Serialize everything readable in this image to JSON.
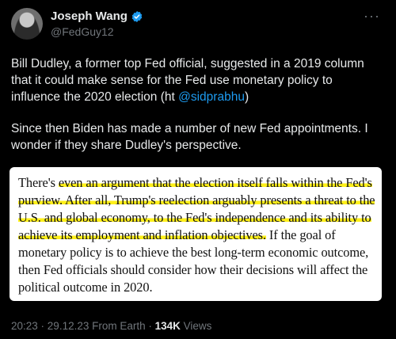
{
  "author": {
    "display_name": "Joseph Wang",
    "handle": "@FedGuy12",
    "verified": true,
    "icons": {
      "verified": "verified-badge-icon",
      "more": "more-options-icon"
    }
  },
  "tweet": {
    "p1_before": "Bill Dudley, a former top Fed official, suggested in a 2019 column that it could make sense for the Fed use monetary policy to influence the 2020 election (ht ",
    "p1_link": "@sidprabhu",
    "p1_after": ")",
    "p2": "Since then Biden has made a number of new Fed appointments. I wonder if they share Dudley's perspective."
  },
  "quote": {
    "lead": "There's ",
    "highlight": "even an argument that the election itself falls within the Fed's purview. After all, Trump's reelection arguably presents a threat to the U.S. and global economy, to the Fed's independence and its ability to achieve its employment and inflation objectives.",
    "tail": " If the goal of monetary policy is to achieve the best long-term economic outcome, then Fed officials should consider how their decisions will affect the political outcome in 2020."
  },
  "meta": {
    "time": "20:23",
    "sep1": " · ",
    "date": "29.12.23",
    "source": " From Earth",
    "sep2": " · ",
    "views_count": "134K",
    "views_label": " Views"
  },
  "colors": {
    "background": "#000000",
    "text": "#e7e9ea",
    "muted": "#71767b",
    "link": "#1d9bf0",
    "highlight": "#fff01a"
  }
}
